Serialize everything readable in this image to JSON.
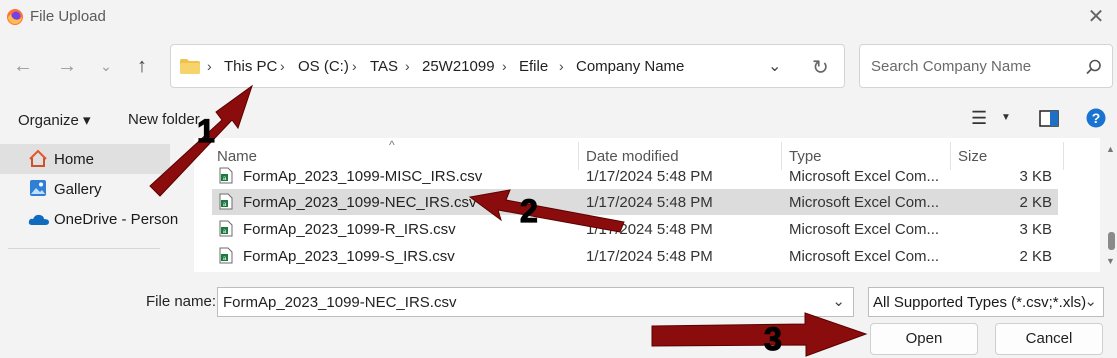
{
  "window": {
    "title": "File Upload"
  },
  "address": {
    "crumbs": [
      "This PC",
      "OS (C:)",
      "TAS",
      "25W21099",
      "Efile",
      "Company Name"
    ]
  },
  "search": {
    "placeholder": "Search Company Name"
  },
  "toolbar": {
    "organize_label": "Organize ▾",
    "new_folder_label": "New folder"
  },
  "sidebar": {
    "items": [
      {
        "label": "Home"
      },
      {
        "label": "Gallery"
      },
      {
        "label": "OneDrive - Person"
      }
    ]
  },
  "columns": {
    "name": "Name",
    "date": "Date modified",
    "type": "Type",
    "size": "Size"
  },
  "files": [
    {
      "name": "FormAp_2023_1099-MISC_IRS.csv",
      "date": "1/17/2024 5:48 PM",
      "type": "Microsoft Excel Com...",
      "size": "3 KB"
    },
    {
      "name": "FormAp_2023_1099-NEC_IRS.csv",
      "date": "1/17/2024 5:48 PM",
      "type": "Microsoft Excel Com...",
      "size": "2 KB"
    },
    {
      "name": "FormAp_2023_1099-R_IRS.csv",
      "date": "1/17/2024 5:48 PM",
      "type": "Microsoft Excel Com...",
      "size": "3 KB"
    },
    {
      "name": "FormAp_2023_1099-S_IRS.csv",
      "date": "1/17/2024 5:48 PM",
      "type": "Microsoft Excel Com...",
      "size": "2 KB"
    }
  ],
  "footer": {
    "file_name_label": "File name:",
    "file_name_value": "FormAp_2023_1099-NEC_IRS.csv",
    "file_type": "All Supported Types (*.csv;*.xls)",
    "open_label": "Open",
    "cancel_label": "Cancel"
  },
  "annotations": {
    "arrow1": "1",
    "arrow2": "2",
    "arrow3": "3"
  },
  "colors": {
    "arrow": "#8b0c0c",
    "selection": "#dcdcdc",
    "accent": "#0067c0"
  }
}
